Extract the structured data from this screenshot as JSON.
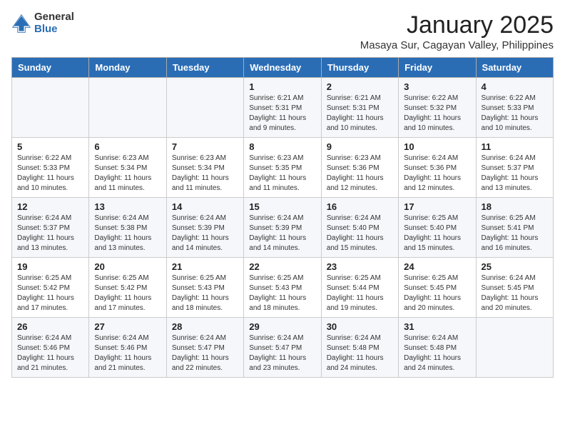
{
  "header": {
    "logo_general": "General",
    "logo_blue": "Blue",
    "month_title": "January 2025",
    "location": "Masaya Sur, Cagayan Valley, Philippines"
  },
  "days_of_week": [
    "Sunday",
    "Monday",
    "Tuesday",
    "Wednesday",
    "Thursday",
    "Friday",
    "Saturday"
  ],
  "weeks": [
    [
      {
        "day": "",
        "info": ""
      },
      {
        "day": "",
        "info": ""
      },
      {
        "day": "",
        "info": ""
      },
      {
        "day": "1",
        "info": "Sunrise: 6:21 AM\nSunset: 5:31 PM\nDaylight: 11 hours and 9 minutes."
      },
      {
        "day": "2",
        "info": "Sunrise: 6:21 AM\nSunset: 5:31 PM\nDaylight: 11 hours and 10 minutes."
      },
      {
        "day": "3",
        "info": "Sunrise: 6:22 AM\nSunset: 5:32 PM\nDaylight: 11 hours and 10 minutes."
      },
      {
        "day": "4",
        "info": "Sunrise: 6:22 AM\nSunset: 5:33 PM\nDaylight: 11 hours and 10 minutes."
      }
    ],
    [
      {
        "day": "5",
        "info": "Sunrise: 6:22 AM\nSunset: 5:33 PM\nDaylight: 11 hours and 10 minutes."
      },
      {
        "day": "6",
        "info": "Sunrise: 6:23 AM\nSunset: 5:34 PM\nDaylight: 11 hours and 11 minutes."
      },
      {
        "day": "7",
        "info": "Sunrise: 6:23 AM\nSunset: 5:34 PM\nDaylight: 11 hours and 11 minutes."
      },
      {
        "day": "8",
        "info": "Sunrise: 6:23 AM\nSunset: 5:35 PM\nDaylight: 11 hours and 11 minutes."
      },
      {
        "day": "9",
        "info": "Sunrise: 6:23 AM\nSunset: 5:36 PM\nDaylight: 11 hours and 12 minutes."
      },
      {
        "day": "10",
        "info": "Sunrise: 6:24 AM\nSunset: 5:36 PM\nDaylight: 11 hours and 12 minutes."
      },
      {
        "day": "11",
        "info": "Sunrise: 6:24 AM\nSunset: 5:37 PM\nDaylight: 11 hours and 13 minutes."
      }
    ],
    [
      {
        "day": "12",
        "info": "Sunrise: 6:24 AM\nSunset: 5:37 PM\nDaylight: 11 hours and 13 minutes."
      },
      {
        "day": "13",
        "info": "Sunrise: 6:24 AM\nSunset: 5:38 PM\nDaylight: 11 hours and 13 minutes."
      },
      {
        "day": "14",
        "info": "Sunrise: 6:24 AM\nSunset: 5:39 PM\nDaylight: 11 hours and 14 minutes."
      },
      {
        "day": "15",
        "info": "Sunrise: 6:24 AM\nSunset: 5:39 PM\nDaylight: 11 hours and 14 minutes."
      },
      {
        "day": "16",
        "info": "Sunrise: 6:24 AM\nSunset: 5:40 PM\nDaylight: 11 hours and 15 minutes."
      },
      {
        "day": "17",
        "info": "Sunrise: 6:25 AM\nSunset: 5:40 PM\nDaylight: 11 hours and 15 minutes."
      },
      {
        "day": "18",
        "info": "Sunrise: 6:25 AM\nSunset: 5:41 PM\nDaylight: 11 hours and 16 minutes."
      }
    ],
    [
      {
        "day": "19",
        "info": "Sunrise: 6:25 AM\nSunset: 5:42 PM\nDaylight: 11 hours and 17 minutes."
      },
      {
        "day": "20",
        "info": "Sunrise: 6:25 AM\nSunset: 5:42 PM\nDaylight: 11 hours and 17 minutes."
      },
      {
        "day": "21",
        "info": "Sunrise: 6:25 AM\nSunset: 5:43 PM\nDaylight: 11 hours and 18 minutes."
      },
      {
        "day": "22",
        "info": "Sunrise: 6:25 AM\nSunset: 5:43 PM\nDaylight: 11 hours and 18 minutes."
      },
      {
        "day": "23",
        "info": "Sunrise: 6:25 AM\nSunset: 5:44 PM\nDaylight: 11 hours and 19 minutes."
      },
      {
        "day": "24",
        "info": "Sunrise: 6:25 AM\nSunset: 5:45 PM\nDaylight: 11 hours and 20 minutes."
      },
      {
        "day": "25",
        "info": "Sunrise: 6:24 AM\nSunset: 5:45 PM\nDaylight: 11 hours and 20 minutes."
      }
    ],
    [
      {
        "day": "26",
        "info": "Sunrise: 6:24 AM\nSunset: 5:46 PM\nDaylight: 11 hours and 21 minutes."
      },
      {
        "day": "27",
        "info": "Sunrise: 6:24 AM\nSunset: 5:46 PM\nDaylight: 11 hours and 21 minutes."
      },
      {
        "day": "28",
        "info": "Sunrise: 6:24 AM\nSunset: 5:47 PM\nDaylight: 11 hours and 22 minutes."
      },
      {
        "day": "29",
        "info": "Sunrise: 6:24 AM\nSunset: 5:47 PM\nDaylight: 11 hours and 23 minutes."
      },
      {
        "day": "30",
        "info": "Sunrise: 6:24 AM\nSunset: 5:48 PM\nDaylight: 11 hours and 24 minutes."
      },
      {
        "day": "31",
        "info": "Sunrise: 6:24 AM\nSunset: 5:48 PM\nDaylight: 11 hours and 24 minutes."
      },
      {
        "day": "",
        "info": ""
      }
    ]
  ]
}
